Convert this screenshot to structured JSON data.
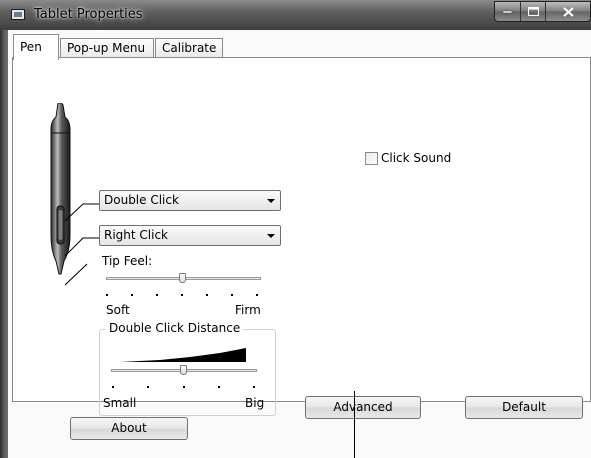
{
  "window": {
    "title": "Tablet Properties"
  },
  "tabs": [
    {
      "label": "Pen",
      "active": true
    },
    {
      "label": "Pop-up Menu",
      "active": false
    },
    {
      "label": "Calibrate",
      "active": false
    }
  ],
  "pen": {
    "upper_switch": {
      "value": "Double Click"
    },
    "lower_switch": {
      "value": "Right Click"
    },
    "tip_feel": {
      "label": "Tip Feel:",
      "min_label": "Soft",
      "max_label": "Firm",
      "level": 0.5
    },
    "double_click_distance": {
      "label": "Double Click Distance",
      "min_label": "Small",
      "max_label": "Big",
      "level": 0.5
    },
    "click_sound": {
      "label": "Click Sound",
      "checked": false
    }
  },
  "buttons": {
    "advanced": "Advanced",
    "default": "Default",
    "about": "About"
  },
  "icons": {
    "title": "tablet-icon",
    "pen": "pen-icon",
    "dropdown": "chevron-down-icon"
  }
}
